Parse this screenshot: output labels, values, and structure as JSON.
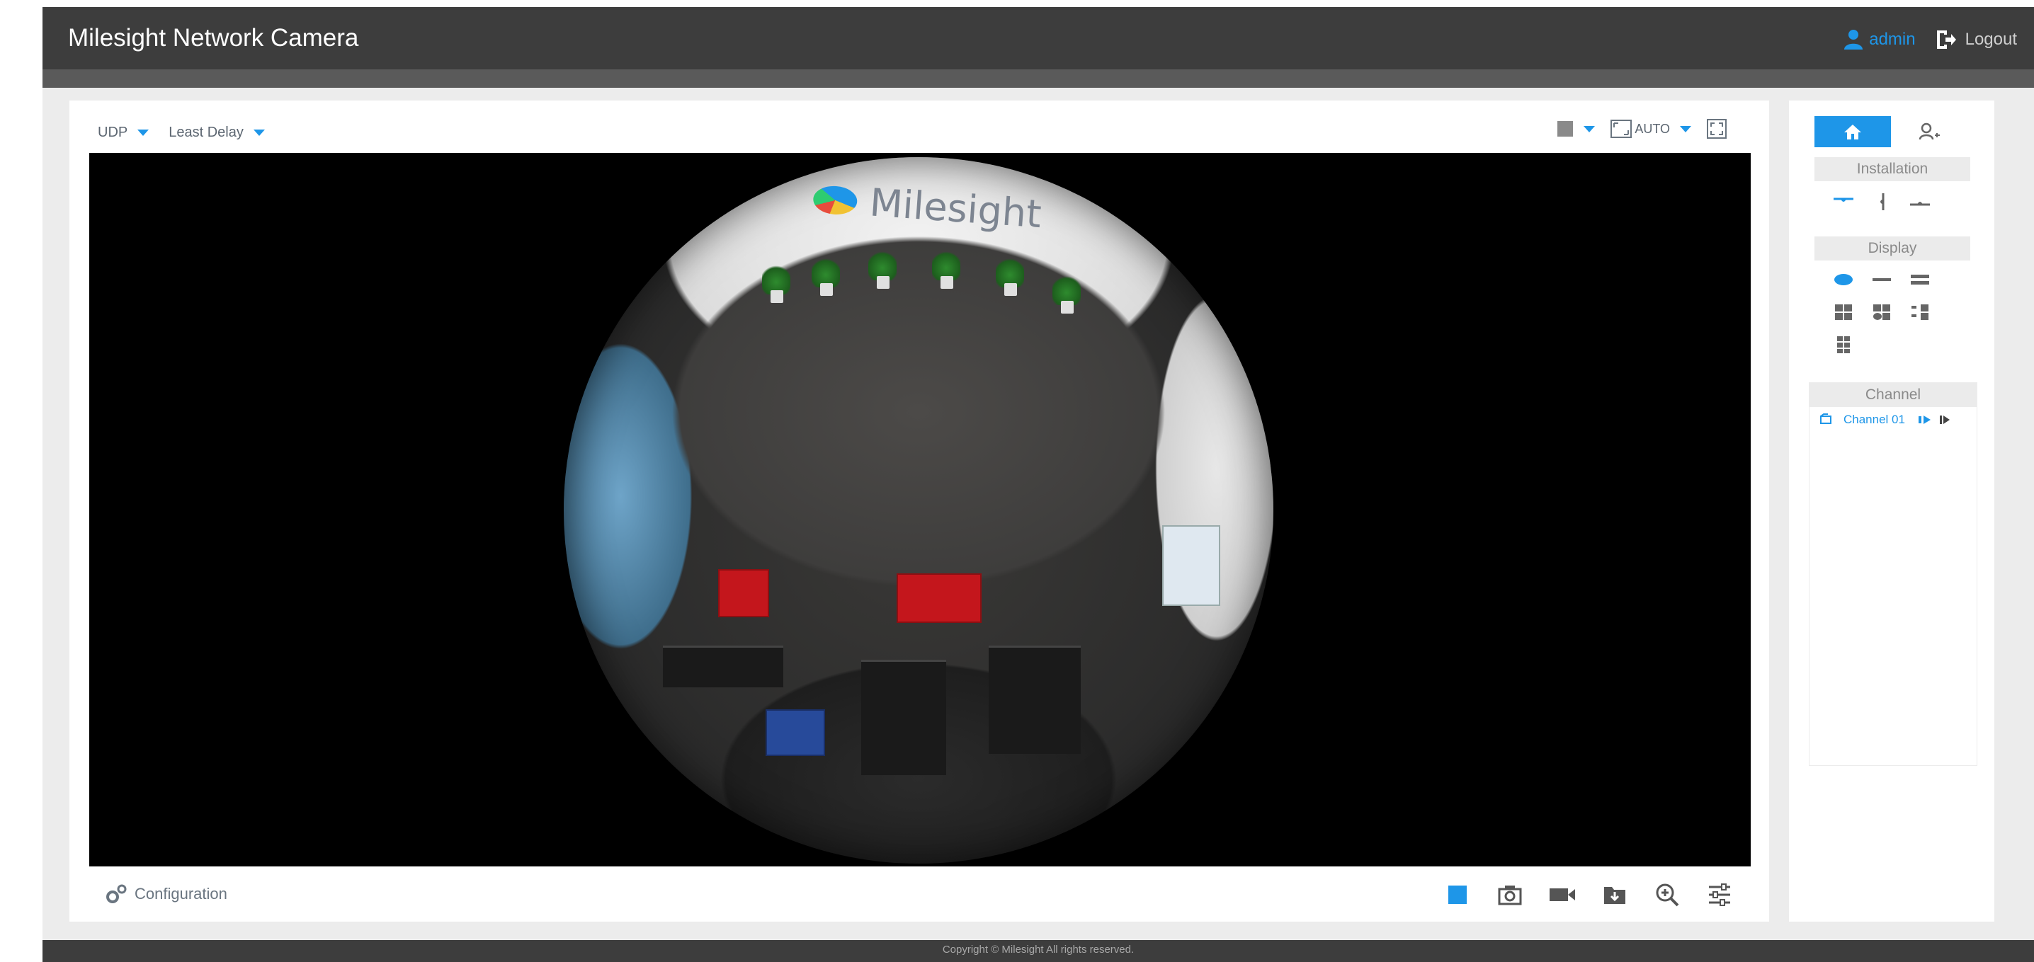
{
  "header": {
    "title": "Milesight Network Camera",
    "user": "admin",
    "logout": "Logout"
  },
  "toolbar": {
    "protocol": "UDP",
    "stream_mode": "Least Delay",
    "ratio": "AUTO"
  },
  "video": {
    "brand_text": "Milesight"
  },
  "bottom": {
    "configuration": "Configuration"
  },
  "side_panel": {
    "tabs": [
      "home-icon",
      "ptz-icon"
    ],
    "installation": "Installation",
    "display": "Display",
    "channel_header": "Channel",
    "channels": [
      {
        "label": "Channel 01"
      }
    ]
  },
  "footer": {
    "copyright": "Copyright © Milesight All rights reserved."
  },
  "colors": {
    "accent": "#1e96e8",
    "header_bg": "#3d3d3d"
  }
}
